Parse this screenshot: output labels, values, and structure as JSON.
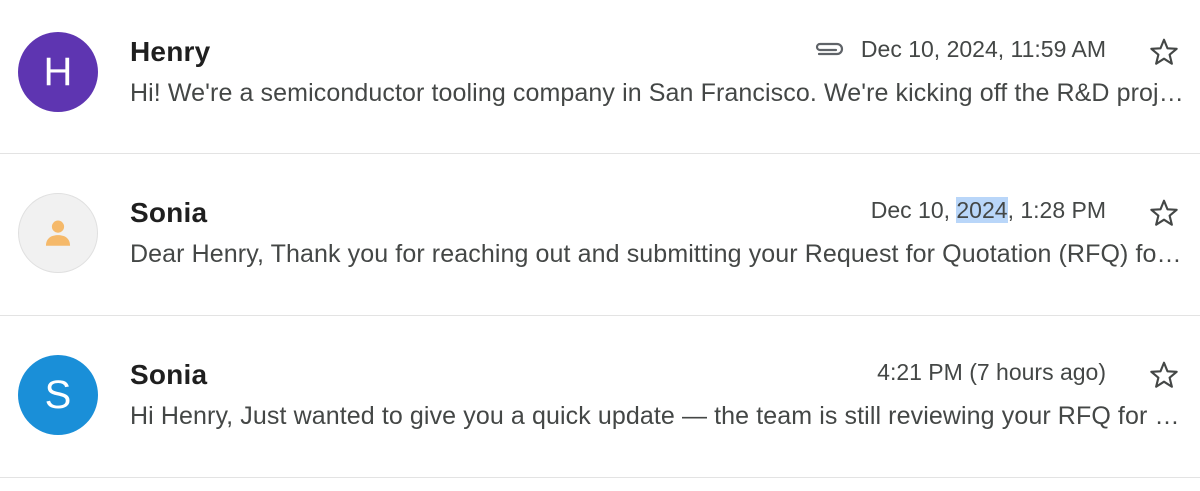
{
  "threads": [
    {
      "sender": "Henry",
      "avatar_letter": "H",
      "avatar_color": "#5e35b1",
      "has_attachment": true,
      "date_parts": [
        "Dec 10, 2024, 11:59 AM"
      ],
      "snippet": "Hi! We're a semiconductor tooling company in San Francisco. We're kicking off the R&D project and would like to request a quotation",
      "starred": false
    },
    {
      "sender": "Sonia",
      "avatar_type": "person-placeholder",
      "avatar_color": "#f1f1f1",
      "avatar_icon_color": "#f5b96a",
      "has_attachment": false,
      "date_pre": "Dec 10, ",
      "date_highlight": "2024",
      "date_post": ", 1:28 PM",
      "snippet": "Dear Henry, Thank you for reaching out and submitting your Request for Quotation (RFQ) for the R&D project",
      "starred": false
    },
    {
      "sender": "Sonia",
      "avatar_letter": "S",
      "avatar_color": "#1a8fd8",
      "has_attachment": false,
      "date_text": "4:21 PM (7 hours ago)",
      "snippet": "Hi Henry, Just wanted to give you a quick update — the team is still reviewing your RFQ for the R&D project",
      "starred": false
    }
  ],
  "colors": {
    "highlight": "#b9d6f9",
    "divider": "#e3e3e3",
    "text_primary": "#1f1f1f",
    "text_secondary": "#444746"
  },
  "icons": {
    "attachment": "paperclip-icon",
    "star": "star-outline-icon",
    "person": "person-icon"
  }
}
